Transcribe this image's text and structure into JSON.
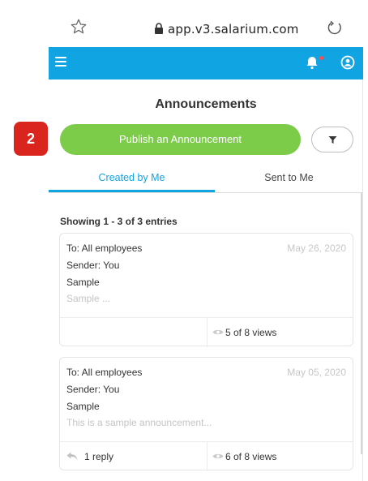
{
  "browser": {
    "url": "app.v3.salarium.com",
    "icons": [
      "star-icon",
      "lock-icon",
      "reload-icon"
    ]
  },
  "header": {
    "icons": [
      "hamburger-icon",
      "bell-icon",
      "user-icon"
    ],
    "accent_color": "#10a4e2",
    "notification_dot_color": "#ff4d4d"
  },
  "page": {
    "title": "Announcements"
  },
  "step_badge": "2",
  "actions": {
    "publish_label": "Publish an Announcement",
    "publish_color": "#7ccc4a",
    "filter_icon": "filter-icon"
  },
  "tabs": [
    {
      "label": "Created by Me",
      "active": true
    },
    {
      "label": "Sent to Me",
      "active": false
    }
  ],
  "list": {
    "showing": "Showing 1 - 3 of 3 entries",
    "items": [
      {
        "to": "To: All employees",
        "date": "May 26, 2020",
        "sender": "Sender: You",
        "subject": "Sample",
        "preview": "Sample ...",
        "reply": "",
        "views": "5 of 8 views"
      },
      {
        "to": "To: All employees",
        "date": "May 05, 2020",
        "sender": "Sender: You",
        "subject": "Sample",
        "preview": "This is a sample announcement...",
        "reply": "1 reply",
        "views": "6 of 8 views"
      }
    ]
  }
}
